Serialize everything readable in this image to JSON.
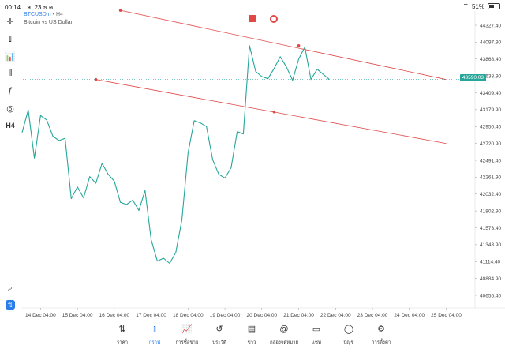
{
  "status_bar": {
    "time": "00:14",
    "date": "ส. 23 ธ.ค.",
    "battery": "51%",
    "battery_level": 0.51
  },
  "symbol": {
    "name": "BTCUSDm",
    "timeframe": "H4",
    "description": "Bitcoin vs US Dollar"
  },
  "sidebar_tools": [
    {
      "icon": "crosshair-icon",
      "glyph": "✛"
    },
    {
      "icon": "candlestick-icon",
      "glyph": "⫾"
    },
    {
      "icon": "indicator-chart-icon",
      "glyph": "📊"
    },
    {
      "icon": "objects-list-icon",
      "glyph": "⦀"
    },
    {
      "icon": "function-icon",
      "glyph": "ƒ"
    },
    {
      "icon": "draw-shapes-icon",
      "glyph": "◎"
    },
    {
      "icon": "timeframe-h4-icon",
      "glyph": "H4"
    }
  ],
  "bottom_left_tools": [
    {
      "icon": "search-zoom-icon",
      "glyph": "⌕"
    },
    {
      "icon": "one-click-trade-icon",
      "glyph": "⇅"
    }
  ],
  "current_price": "43590.03",
  "tabs": [
    {
      "name": "tab-quotes",
      "icon": "arrows-updown-icon",
      "glyph": "⇅",
      "label": "ราคา",
      "active": false
    },
    {
      "name": "tab-chart",
      "icon": "candlestick-icon",
      "glyph": "⫾",
      "label": "กราฟ",
      "active": true
    },
    {
      "name": "tab-trade",
      "icon": "trade-chart-icon",
      "glyph": "📈",
      "label": "การซื้อขาย",
      "active": false
    },
    {
      "name": "tab-history",
      "icon": "history-icon",
      "glyph": "↺",
      "label": "ประวัติ",
      "active": false
    },
    {
      "name": "tab-news",
      "icon": "news-icon",
      "glyph": "▤",
      "label": "ข่าว",
      "active": false
    },
    {
      "name": "tab-mailbox",
      "icon": "mail-at-icon",
      "glyph": "@",
      "label": "กล่องจดหมาย",
      "active": false
    },
    {
      "name": "tab-chat",
      "icon": "chat-icon",
      "glyph": "▭",
      "label": "แชท",
      "active": false
    },
    {
      "name": "tab-account",
      "icon": "account-icon",
      "glyph": "◯",
      "label": "บัญชี",
      "active": false
    },
    {
      "name": "tab-settings",
      "icon": "gear-icon",
      "glyph": "⚙",
      "label": "การตั้งค่า",
      "active": false
    }
  ],
  "colors": {
    "line": "#26a69a",
    "trendline": "#e04747",
    "accent": "#2b7de9",
    "price_tag": "#26a69a",
    "grid": "#eeeeee"
  },
  "chart_data": {
    "type": "line",
    "title": "",
    "ylim": [
      40425.0,
      44557.0
    ],
    "xlim": [
      1,
      52
    ],
    "y_ticks": [
      "44327.40",
      "44097.90",
      "43868.40",
      "43638.90",
      "43409.40",
      "43179.90",
      "42950.40",
      "42720.90",
      "42491.40",
      "42261.90",
      "42032.40",
      "41802.90",
      "41573.40",
      "41343.90",
      "41114.40",
      "40884.90",
      "40655.40"
    ],
    "x_tick_labels": [
      "14 Dec 04:00",
      "15 Dec 04:00",
      "16 Dec 04:00",
      "17 Dec 04:00",
      "18 Dec 04:00",
      "19 Dec 04:00",
      "20 Dec 04:00",
      "21 Dec 04:00",
      "22 Dec 04:00",
      "23 Dec 04:00",
      "24 Dec 04:00",
      "25 Dec 04:00"
    ],
    "x_tick_positions": [
      3,
      9,
      15,
      21,
      27,
      33,
      39,
      45,
      51,
      57,
      63,
      69
    ],
    "series": [
      {
        "values": [
          {
            "x": 0,
            "y": 42870
          },
          {
            "x": 1,
            "y": 43175
          },
          {
            "x": 2,
            "y": 42520
          },
          {
            "x": 3,
            "y": 43100
          },
          {
            "x": 4,
            "y": 43040
          },
          {
            "x": 5,
            "y": 42820
          },
          {
            "x": 6,
            "y": 42760
          },
          {
            "x": 7,
            "y": 42790
          },
          {
            "x": 8,
            "y": 41970
          },
          {
            "x": 9,
            "y": 42130
          },
          {
            "x": 10,
            "y": 41980
          },
          {
            "x": 11,
            "y": 42270
          },
          {
            "x": 12,
            "y": 42180
          },
          {
            "x": 13,
            "y": 42450
          },
          {
            "x": 14,
            "y": 42300
          },
          {
            "x": 15,
            "y": 42210
          },
          {
            "x": 16,
            "y": 41920
          },
          {
            "x": 17,
            "y": 41890
          },
          {
            "x": 18,
            "y": 41950
          },
          {
            "x": 19,
            "y": 41810
          },
          {
            "x": 20,
            "y": 42080
          },
          {
            "x": 21,
            "y": 41410
          },
          {
            "x": 22,
            "y": 41120
          },
          {
            "x": 23,
            "y": 41160
          },
          {
            "x": 24,
            "y": 41090
          },
          {
            "x": 25,
            "y": 41240
          },
          {
            "x": 26,
            "y": 41680
          },
          {
            "x": 27,
            "y": 42590
          },
          {
            "x": 28,
            "y": 43030
          },
          {
            "x": 29,
            "y": 43000
          },
          {
            "x": 30,
            "y": 42950
          },
          {
            "x": 31,
            "y": 42500
          },
          {
            "x": 32,
            "y": 42300
          },
          {
            "x": 33,
            "y": 42250
          },
          {
            "x": 34,
            "y": 42390
          },
          {
            "x": 35,
            "y": 42880
          },
          {
            "x": 36,
            "y": 42850
          },
          {
            "x": 37,
            "y": 44050
          },
          {
            "x": 38,
            "y": 43700
          },
          {
            "x": 39,
            "y": 43630
          },
          {
            "x": 40,
            "y": 43600
          },
          {
            "x": 41,
            "y": 43740
          },
          {
            "x": 42,
            "y": 43900
          },
          {
            "x": 43,
            "y": 43760
          },
          {
            "x": 44,
            "y": 43580
          },
          {
            "x": 45,
            "y": 43870
          },
          {
            "x": 46,
            "y": 44030
          },
          {
            "x": 47,
            "y": 43590
          },
          {
            "x": 48,
            "y": 43730
          },
          {
            "x": 49,
            "y": 43660
          },
          {
            "x": 50,
            "y": 43590
          }
        ]
      }
    ],
    "trendlines": [
      {
        "points": [
          {
            "x": 16,
            "y": 44530
          },
          {
            "x": 69,
            "y": 43590
          }
        ],
        "anchor": {
          "x": 45,
          "y": 44050
        }
      },
      {
        "points": [
          {
            "x": 12,
            "y": 43590
          },
          {
            "x": 69,
            "y": 42720
          }
        ],
        "anchor": {
          "x": 41,
          "y": 43150
        }
      }
    ],
    "current_price_line": 43590.03
  }
}
